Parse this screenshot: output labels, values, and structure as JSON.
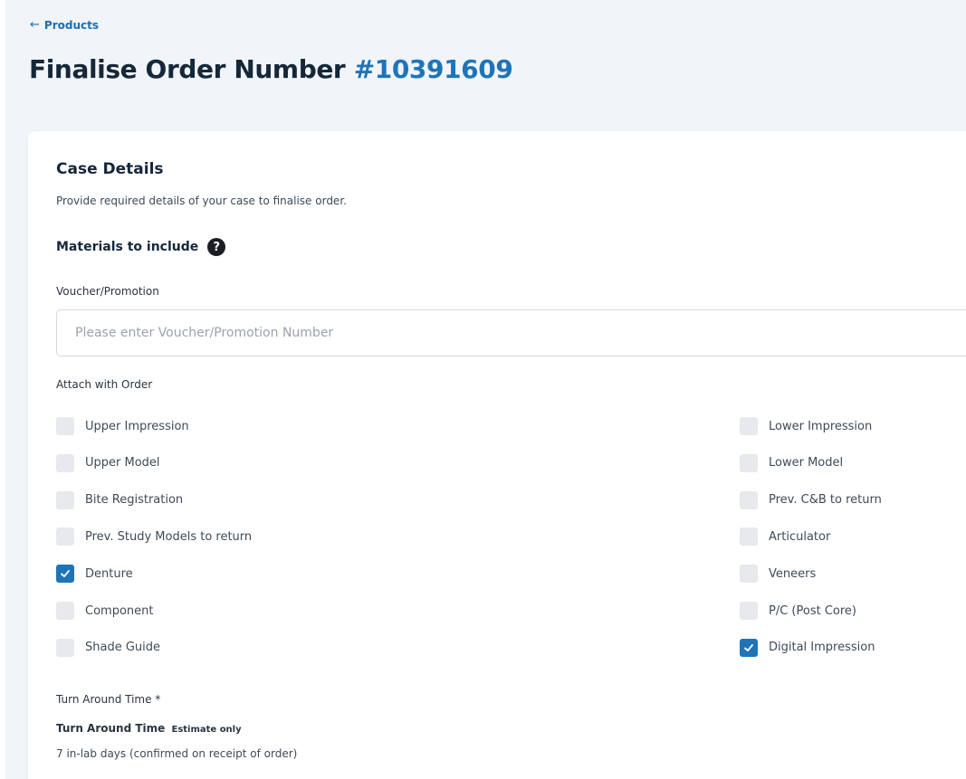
{
  "header": {
    "back_label": "Products",
    "title": "Finalise Order Number",
    "order_number": "#10391609"
  },
  "case_details": {
    "title": "Case Details",
    "subtitle": "Provide required details of your case to finalise order.",
    "materials_heading": "Materials to include",
    "voucher": {
      "label": "Voucher/Promotion",
      "value": "",
      "placeholder": "Please enter Voucher/Promotion Number"
    },
    "attach_label": "Attach with Order",
    "left_items": [
      {
        "label": "Upper Impression",
        "checked": false
      },
      {
        "label": "Upper Model",
        "checked": false
      },
      {
        "label": "Bite Registration",
        "checked": false
      },
      {
        "label": "Prev. Study Models to return",
        "checked": false
      },
      {
        "label": "Denture",
        "checked": true
      },
      {
        "label": "Component",
        "checked": false
      },
      {
        "label": "Shade Guide",
        "checked": false
      }
    ],
    "right_items": [
      {
        "label": "Lower Impression",
        "checked": false
      },
      {
        "label": "Lower Model",
        "checked": false
      },
      {
        "label": "Prev. C&B to return",
        "checked": false
      },
      {
        "label": "Articulator",
        "checked": false
      },
      {
        "label": "Veneers",
        "checked": false
      },
      {
        "label": "P/C (Post Core)",
        "checked": false
      },
      {
        "label": "Digital Impression",
        "checked": true
      }
    ],
    "turnaround": {
      "label": "Turn Around Time *",
      "heading": "Turn Around Time",
      "estimate_note": "Estimate only",
      "value": "7 in-lab days (confirmed on receipt of order)"
    }
  },
  "colors": {
    "accent": "#1f74b8",
    "title": "#15283a",
    "background": "#f1f4f8"
  },
  "icons": {
    "back": "arrow-left-icon",
    "help": "question-circle-icon",
    "check": "checkmark-icon"
  }
}
